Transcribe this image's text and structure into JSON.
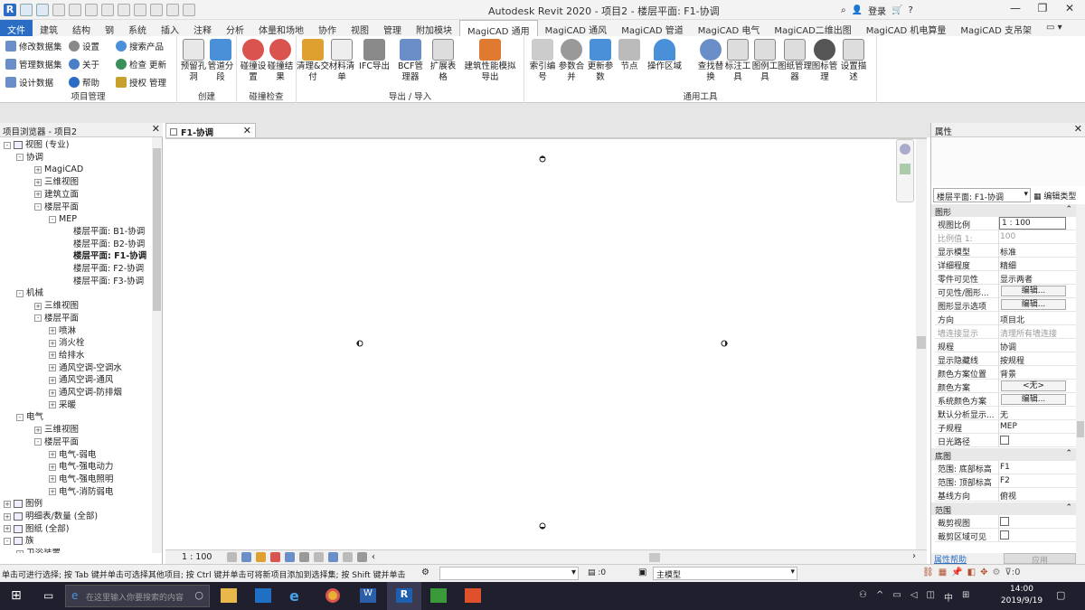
{
  "title": "Autodesk Revit 2020 - 项目2 - 楼层平面: F1-协调",
  "titlebar": {
    "login": "登录"
  },
  "tabs": [
    "文件",
    "建筑",
    "结构",
    "钢",
    "系统",
    "插入",
    "注释",
    "分析",
    "体量和场地",
    "协作",
    "视图",
    "管理",
    "附加模块",
    "MagiCAD 通用",
    "MagiCAD 通风",
    "MagiCAD 管道",
    "MagiCAD 电气",
    "MagiCAD二维出图",
    "MagiCAD 机电算量",
    "MagiCAD 支吊架"
  ],
  "ribbon": {
    "project_mgmt": {
      "title": "项目管理",
      "items": [
        "修改数据集",
        "设置",
        "搜索产品",
        "管理数据集",
        "关于",
        "检查 更新",
        "设计数据",
        "帮助",
        "授权 管理"
      ]
    },
    "create": {
      "title": "创建",
      "buttons": [
        "预留孔洞",
        "管道分段"
      ]
    },
    "collision": {
      "title": "碰撞检查",
      "buttons": [
        "碰撞设置",
        "碰撞结果"
      ]
    },
    "export": {
      "title": "导出 / 导入",
      "buttons": [
        "清理&交付",
        "材料清单",
        "IFC导出",
        "BCF管理器",
        "扩展表格",
        "建筑性能模拟导出"
      ]
    },
    "common": {
      "title": "通用工具",
      "buttons": [
        "索引编号",
        "参数合并",
        "更新参数",
        "节点",
        "操作区域",
        "查找替换",
        "标注工具",
        "图例工具",
        "图纸管理器",
        "图标管理",
        "设置描述"
      ]
    }
  },
  "browser": {
    "title": "项目浏览器 - 项目2",
    "nodes": [
      {
        "label": "视图 (专业)",
        "level": 0,
        "box": "-"
      },
      {
        "label": "协调",
        "level": 1,
        "box": "-"
      },
      {
        "label": "MagiCAD",
        "level": 2,
        "box": "+"
      },
      {
        "label": "三维视图",
        "level": 2,
        "box": "+"
      },
      {
        "label": "建筑立面",
        "level": 2,
        "box": "+"
      },
      {
        "label": "楼层平面",
        "level": 2,
        "box": "-"
      },
      {
        "label": "MEP",
        "level": 3,
        "box": "-"
      },
      {
        "label": "楼层平面: B1-协调",
        "level": 4,
        "box": ""
      },
      {
        "label": "楼层平面: B2-协调",
        "level": 4,
        "box": ""
      },
      {
        "label": "楼层平面: F1-协调",
        "level": 4,
        "box": "",
        "bold": true
      },
      {
        "label": "楼层平面: F2-协调",
        "level": 4,
        "box": ""
      },
      {
        "label": "楼层平面: F3-协调",
        "level": 4,
        "box": ""
      },
      {
        "label": "机械",
        "level": 1,
        "box": "-"
      },
      {
        "label": "三维视图",
        "level": 2,
        "box": "+"
      },
      {
        "label": "楼层平面",
        "level": 2,
        "box": "-"
      },
      {
        "label": "喷淋",
        "level": 3,
        "box": "+"
      },
      {
        "label": "消火栓",
        "level": 3,
        "box": "+"
      },
      {
        "label": "给排水",
        "level": 3,
        "box": "+"
      },
      {
        "label": "通风空调-空调水",
        "level": 3,
        "box": "+"
      },
      {
        "label": "通风空调-通风",
        "level": 3,
        "box": "+"
      },
      {
        "label": "通风空调-防排烟",
        "level": 3,
        "box": "+"
      },
      {
        "label": "采暖",
        "level": 3,
        "box": "+"
      },
      {
        "label": "电气",
        "level": 1,
        "box": "-"
      },
      {
        "label": "三维视图",
        "level": 2,
        "box": "+"
      },
      {
        "label": "楼层平面",
        "level": 2,
        "box": "-"
      },
      {
        "label": "电气-弱电",
        "level": 3,
        "box": "+"
      },
      {
        "label": "电气-强电动力",
        "level": 3,
        "box": "+"
      },
      {
        "label": "电气-强电照明",
        "level": 3,
        "box": "+"
      },
      {
        "label": "电气-消防弱电",
        "level": 3,
        "box": "+"
      },
      {
        "label": "图例",
        "level": 0,
        "box": "+"
      },
      {
        "label": "明细表/数量 (全部)",
        "level": 0,
        "box": "+"
      },
      {
        "label": "图纸 (全部)",
        "level": 0,
        "box": "+"
      },
      {
        "label": "族",
        "level": 0,
        "box": "-"
      },
      {
        "label": "卫浴装置",
        "level": 1,
        "box": "+"
      }
    ]
  },
  "view": {
    "tab_label": "F1-协调",
    "scale": "1 : 100"
  },
  "properties": {
    "title": "属性",
    "type_selector": "楼层平面: F1-协调",
    "edit_type": "编辑类型",
    "section_graphics": "图形",
    "rows": [
      {
        "k": "视图比例",
        "v": "1 : 100",
        "kind": "input"
      },
      {
        "k": "比例值 1:",
        "v": "100",
        "kind": "gray"
      },
      {
        "k": "显示模型",
        "v": "标准"
      },
      {
        "k": "详细程度",
        "v": "精细"
      },
      {
        "k": "零件可见性",
        "v": "显示两者"
      },
      {
        "k": "可见性/图形...",
        "v": "编辑...",
        "kind": "button"
      },
      {
        "k": "图形显示选项",
        "v": "编辑...",
        "kind": "button"
      },
      {
        "k": "方向",
        "v": "项目北"
      },
      {
        "k": "墙连接显示",
        "v": "清理所有墙连接",
        "kind": "gray"
      },
      {
        "k": "规程",
        "v": "协调"
      },
      {
        "k": "显示隐藏线",
        "v": "按规程"
      },
      {
        "k": "颜色方案位置",
        "v": "背景"
      },
      {
        "k": "颜色方案",
        "v": "<无>",
        "kind": "button"
      },
      {
        "k": "系统颜色方案",
        "v": "编辑...",
        "kind": "button"
      },
      {
        "k": "默认分析显示...",
        "v": "无"
      },
      {
        "k": "子规程",
        "v": "MEP"
      },
      {
        "k": "日光路径",
        "v": "",
        "kind": "check"
      }
    ],
    "section_underlay": "底图",
    "underlay_rows": [
      {
        "k": "范围: 底部标高",
        "v": "F1"
      },
      {
        "k": "范围: 顶部标高",
        "v": "F2"
      },
      {
        "k": "基线方向",
        "v": "俯视"
      }
    ],
    "section_extents": "范围",
    "extent_rows": [
      {
        "k": "裁剪视图",
        "v": "",
        "kind": "check"
      },
      {
        "k": "裁剪区域可见",
        "v": "",
        "kind": "check"
      }
    ],
    "help": "属性帮助",
    "apply": "应用"
  },
  "status": {
    "text": "单击可进行选择; 按 Tab 键并单击可选择其他项目; 按 Ctrl 键并单击可将新项目添加到选择集; 按 Shift 键并单击",
    "zero1": ":0",
    "model": "主模型",
    "zero2": ":0"
  },
  "taskbar": {
    "search": "在这里输入你要搜索的内容",
    "time": "14:00",
    "date": "2019/9/19",
    "ime": "中"
  }
}
